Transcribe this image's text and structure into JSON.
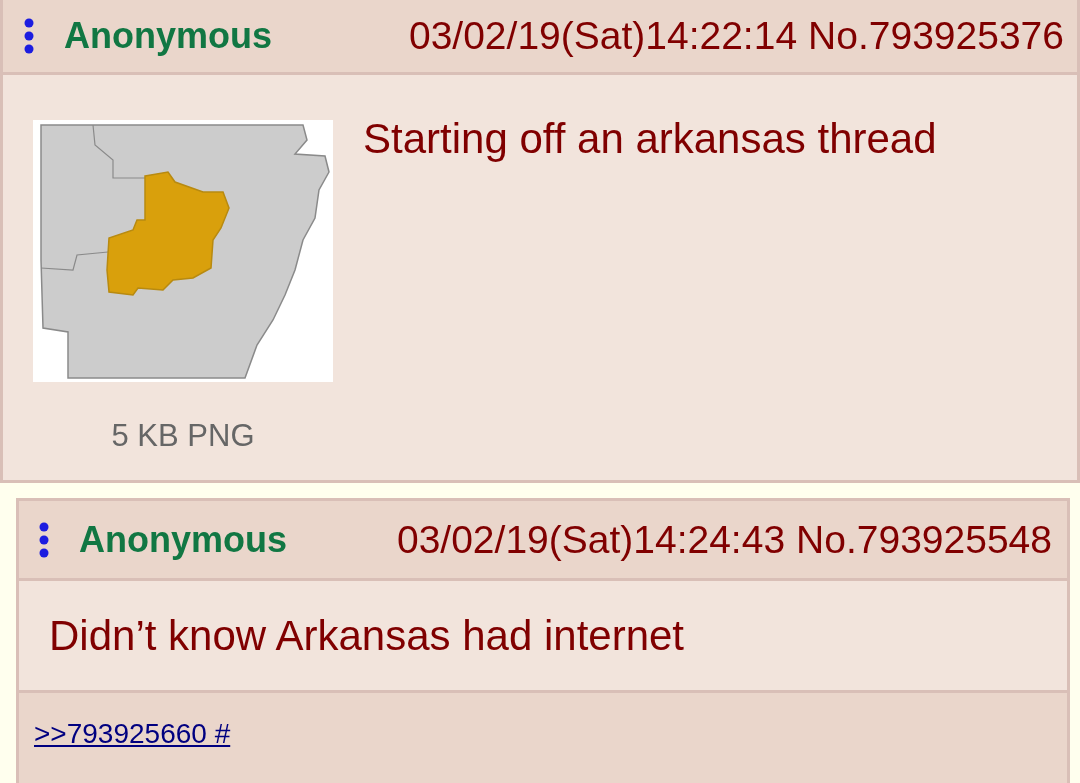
{
  "posts": [
    {
      "kind": "op",
      "name": "Anonymous",
      "date": "03/02/19(Sat)14:22:14",
      "number": "No.793925376",
      "attachment": {
        "file_info": "5 KB PNG"
      },
      "comment": "Starting off an arkansas thread"
    },
    {
      "kind": "reply",
      "name": "Anonymous",
      "date": "03/02/19(Sat)14:24:43",
      "number": "No.793925548",
      "comment": "Didn’t know Arkansas had internet",
      "footer_link": ">>793925660 #"
    }
  ]
}
